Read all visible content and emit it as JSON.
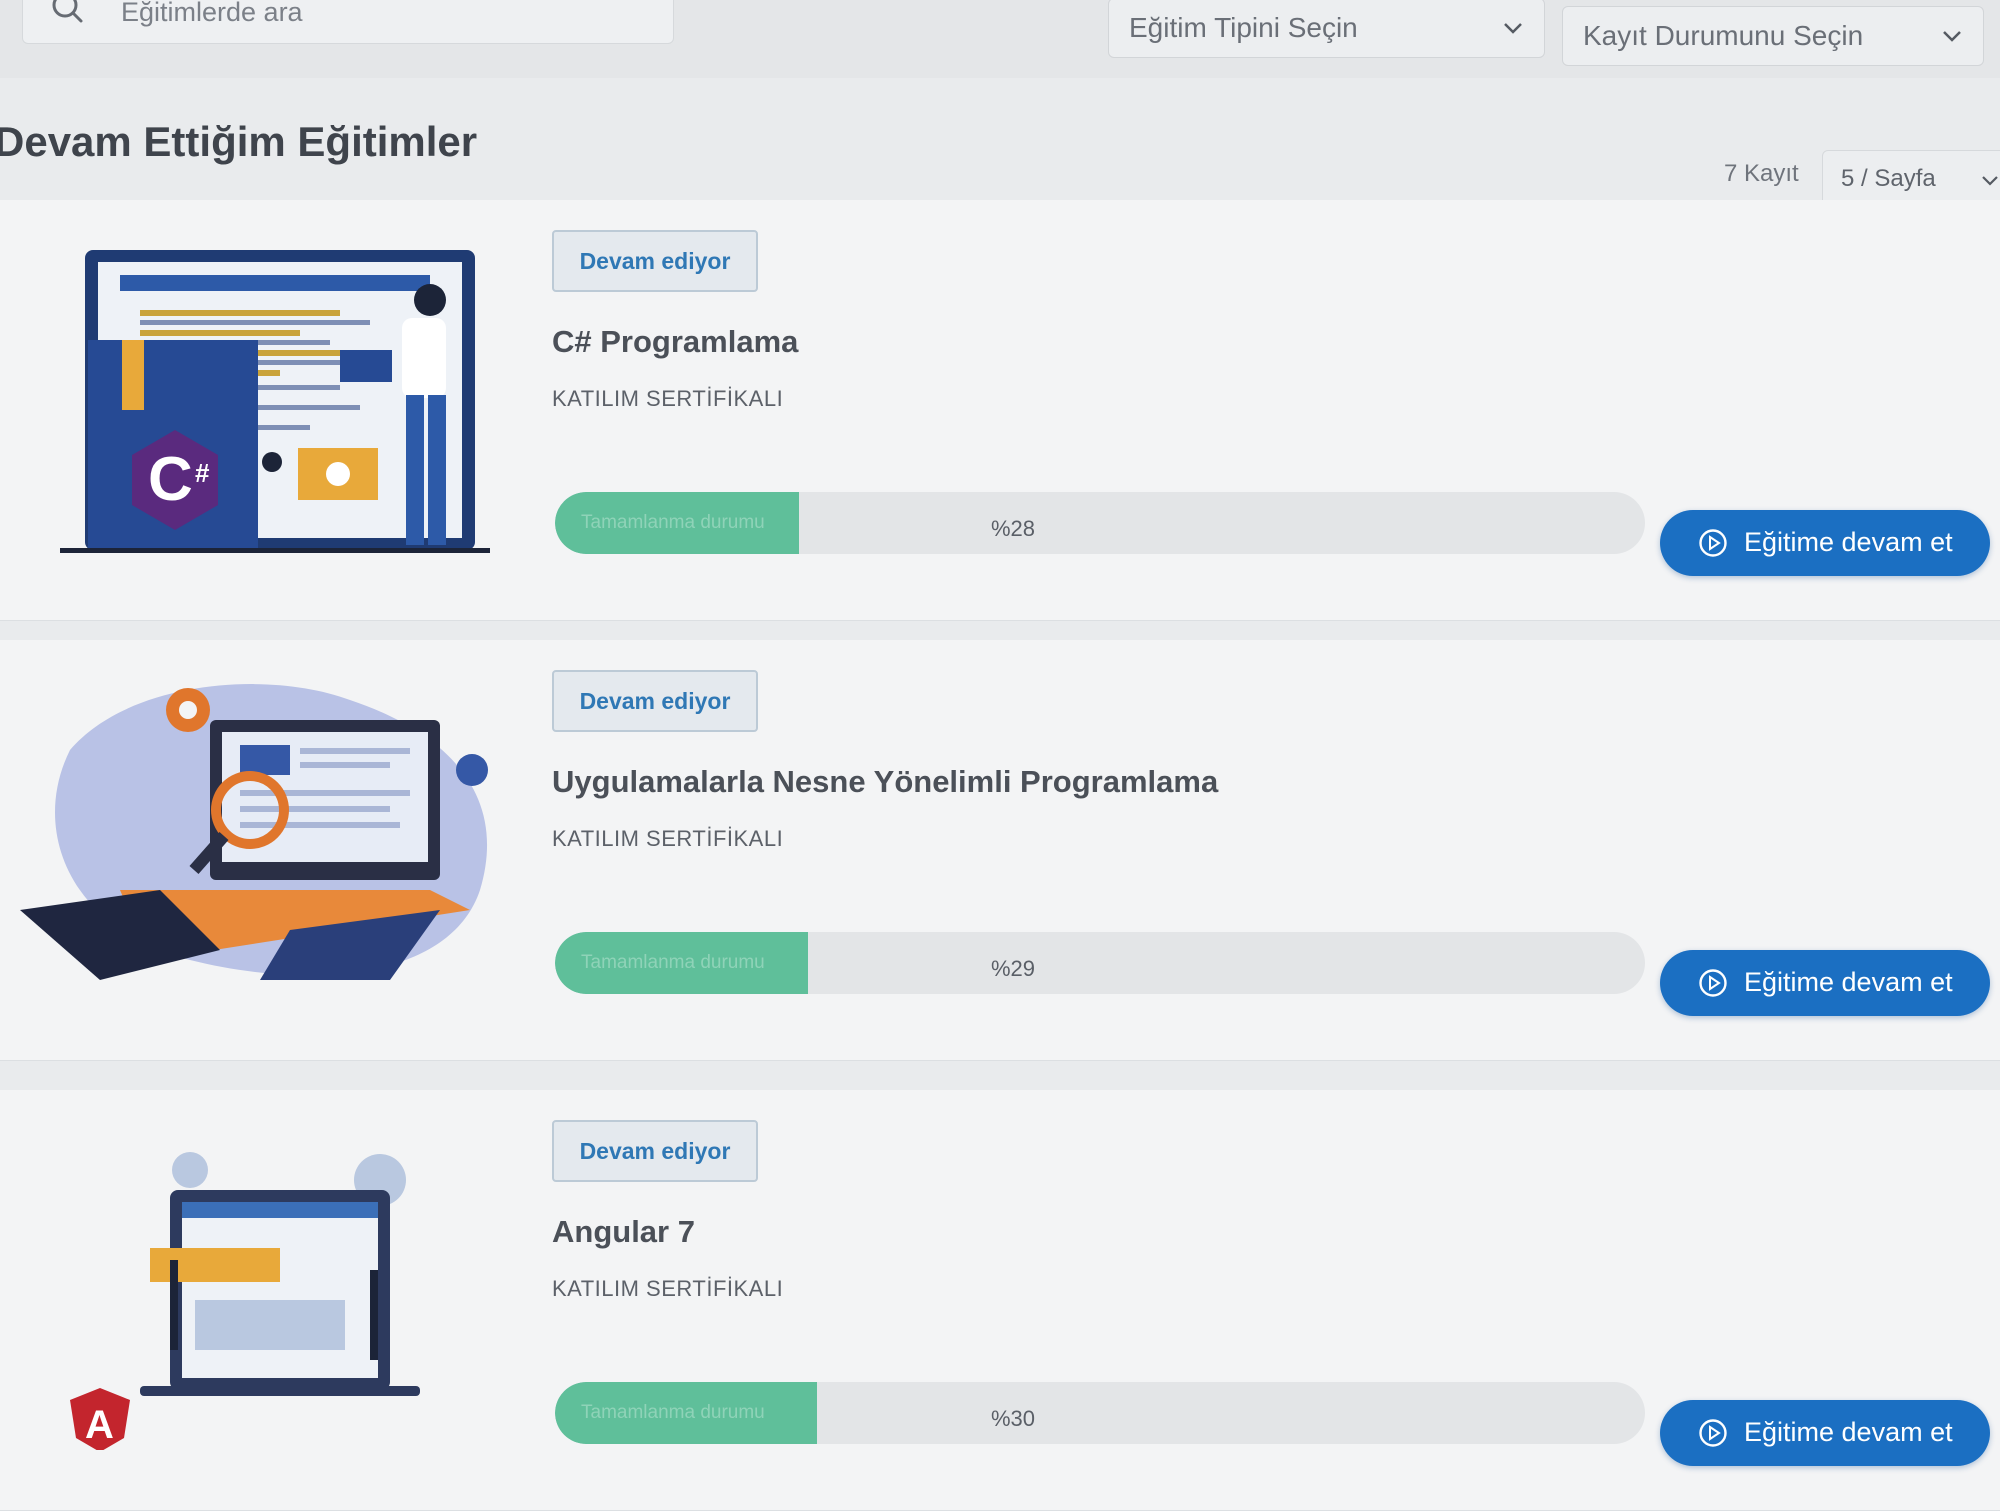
{
  "filters": {
    "search_placeholder": "Eğitimlerde ara",
    "type_select": "Eğitim Tipini Seçin",
    "status_select": "Kayıt Durumunu Seçin"
  },
  "header": {
    "title": "Devam Ettiğim Eğitimler",
    "record_count": "7 Kayıt",
    "per_page": "5 / Sayfa"
  },
  "courses": [
    {
      "status": "Devam ediyor",
      "title": "C# Programlama",
      "certificate": "KATILIM SERTİFİKALI",
      "progress_label": "Tamamlanma durumu",
      "progress": 0.28,
      "progress_text": "%28",
      "action": "Eğitime devam et",
      "illustration_icon": "csharp-illustration-icon"
    },
    {
      "status": "Devam ediyor",
      "title": "Uygulamalarla Nesne Yönelimli Programlama",
      "certificate": "KATILIM SERTİFİKALI",
      "progress_label": "Tamamlanma durumu",
      "progress": 0.29,
      "progress_text": "%29",
      "action": "Eğitime devam et",
      "illustration_icon": "oop-illustration-icon"
    },
    {
      "status": "Devam ediyor",
      "title": "Angular 7",
      "certificate": "KATILIM SERTİFİKALI",
      "progress_label": "Tamamlanma durumu",
      "progress": 0.3,
      "progress_text": "%30",
      "action": "Eğitime devam et",
      "illustration_icon": "angular-illustration-icon"
    }
  ],
  "colors": {
    "accent": "#1b6fc2",
    "progress": "#5fbf9a",
    "badge_text": "#2f78b5"
  }
}
